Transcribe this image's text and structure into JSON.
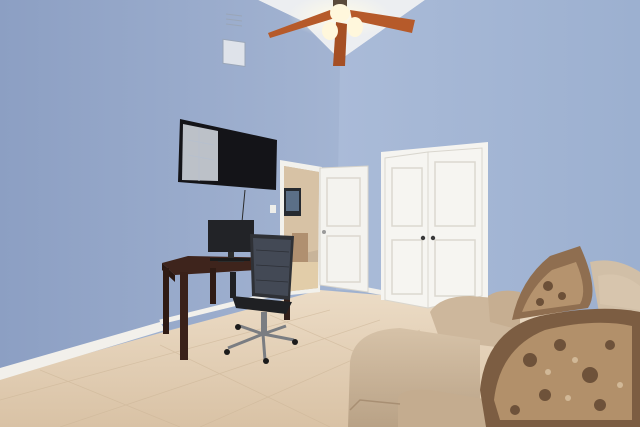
{
  "scene": {
    "subject": "bedroom-office",
    "colors": {
      "wall_left": "#97aacb",
      "wall_right": "#a6b8d6",
      "ceiling": "#e9ebee",
      "floor": "#e3cfb6",
      "trim": "#f3f1ec",
      "door": "#f4f3ef",
      "fan_blade": "#b65a2a",
      "sofa": "#cbb59b",
      "desk": "#4a2a20"
    },
    "icons": [
      "ceiling-fan-icon",
      "tv-icon",
      "monitor-icon",
      "office-chair-icon",
      "sofa-icon",
      "pillow-icon",
      "door-icon",
      "closet-door-icon",
      "air-vent-icon"
    ]
  }
}
